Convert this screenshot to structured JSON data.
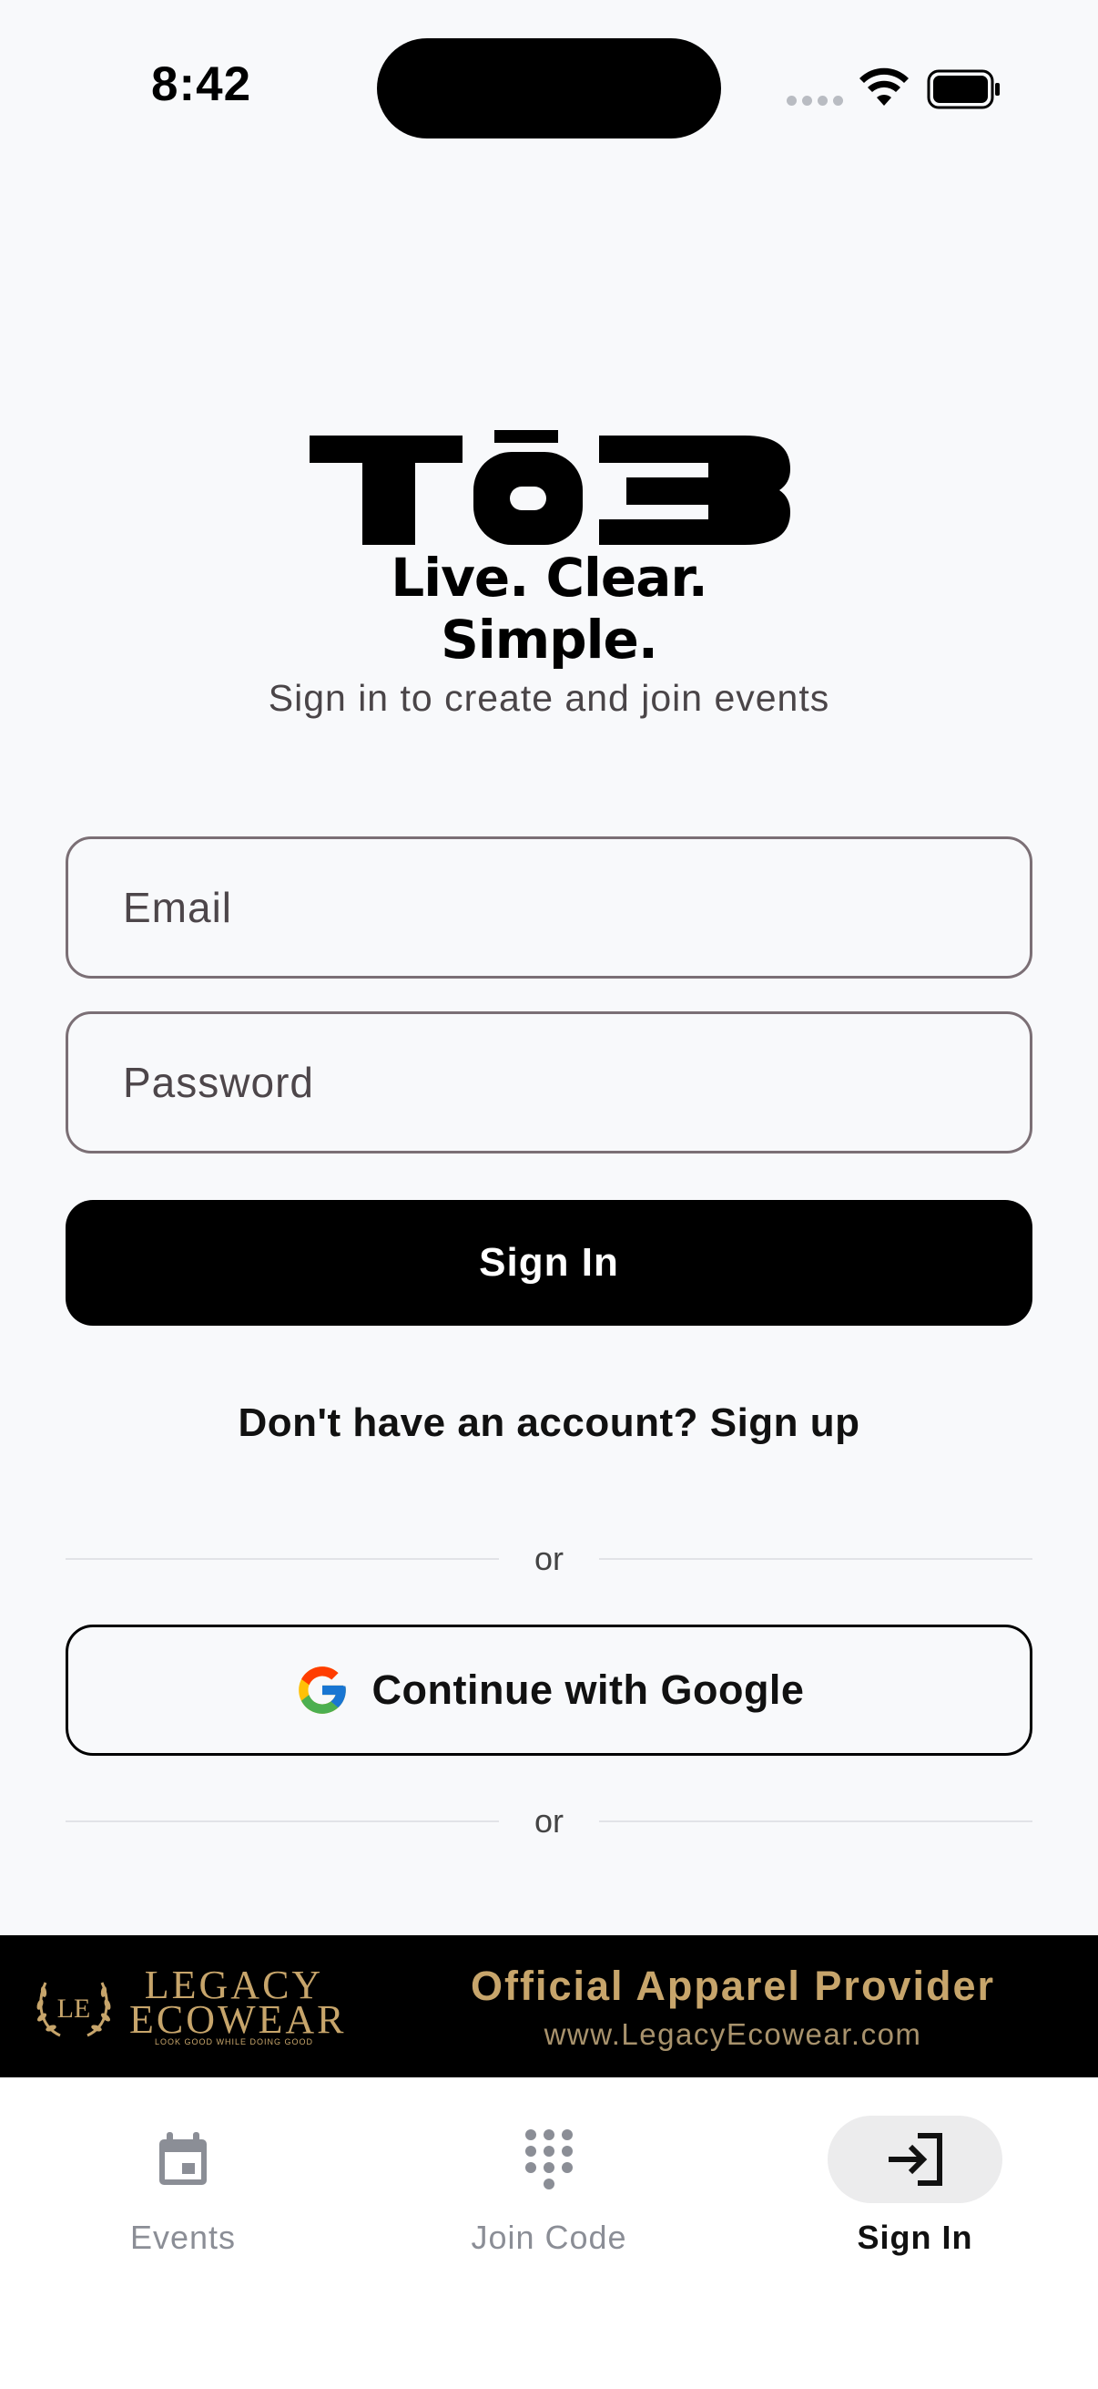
{
  "status_bar": {
    "time": "8:42",
    "icons": [
      "cellular-signal-icon",
      "wifi-icon",
      "battery-icon"
    ]
  },
  "logo": {
    "wordmark": "Tō3",
    "tagline": "Live. Clear. Simple."
  },
  "subtitle": "Sign in to create and join events",
  "form": {
    "email_placeholder": "Email",
    "email_value": "",
    "password_placeholder": "Password",
    "password_value": "",
    "signin_label": "Sign In"
  },
  "signup_text": "Don't have an account? Sign up",
  "divider_text_1": "or",
  "google_button": {
    "label": "Continue with Google",
    "icon": "google-icon"
  },
  "divider_text_2": "or",
  "banner": {
    "brand_line_1": "LEGACY",
    "brand_line_2": "ECOWEAR",
    "brand_tagline": "LOOK GOOD WHILE DOING GOOD",
    "title": "Official Apparel Provider",
    "url": "www.LegacyEcowear.com",
    "accent_color": "#c7a56b"
  },
  "tabbar": {
    "items": [
      {
        "label": "Events",
        "icon": "calendar-icon",
        "active": false
      },
      {
        "label": "Join Code",
        "icon": "keypad-icon",
        "active": false
      },
      {
        "label": "Sign In",
        "icon": "sign-in-icon",
        "active": true
      }
    ]
  }
}
